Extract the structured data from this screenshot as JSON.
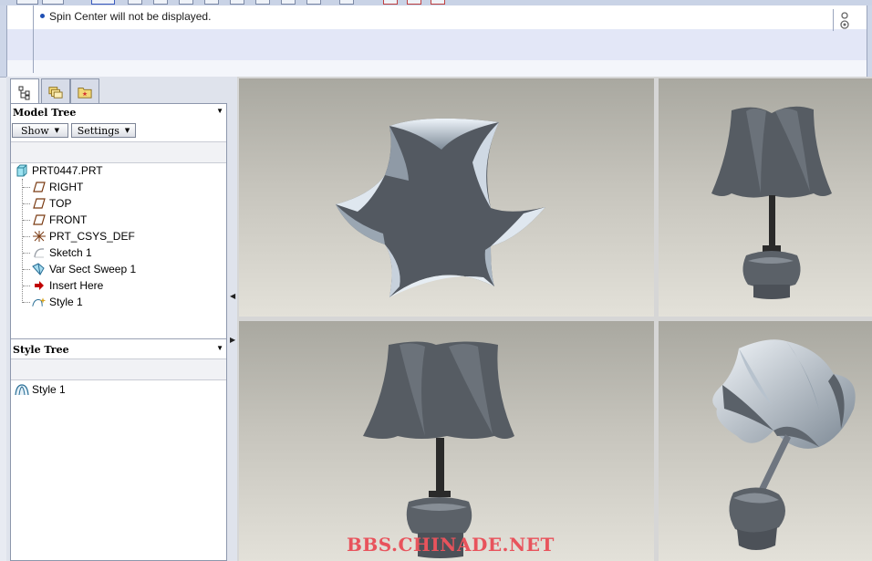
{
  "message_area": {
    "messages": [
      "Spin Center will not be displayed."
    ],
    "side_icon": "question-info-icon"
  },
  "panel_tabs": [
    {
      "name": "model-tree-tab-icon",
      "active": true
    },
    {
      "name": "folder-browser-tab-icon",
      "active": false
    },
    {
      "name": "favorites-tab-icon",
      "active": false
    }
  ],
  "model_tree": {
    "title": "Model Tree",
    "show_label": "Show",
    "settings_label": "Settings",
    "items": [
      {
        "label": "PRT0447.PRT",
        "icon": "part-icon"
      },
      {
        "label": "RIGHT",
        "icon": "datum-plane-icon"
      },
      {
        "label": "TOP",
        "icon": "datum-plane-icon"
      },
      {
        "label": "FRONT",
        "icon": "datum-plane-icon"
      },
      {
        "label": "PRT_CSYS_DEF",
        "icon": "coordinate-system-icon"
      },
      {
        "label": "Sketch 1",
        "icon": "sketch-icon"
      },
      {
        "label": "Var Sect Sweep 1",
        "icon": "sweep-icon"
      },
      {
        "label": "Insert Here",
        "icon": "insert-arrow-icon"
      },
      {
        "label": "Style 1",
        "icon": "style-icon"
      }
    ]
  },
  "style_tree": {
    "title": "Style Tree",
    "items": [
      {
        "label": "Style 1",
        "icon": "style-icon"
      }
    ]
  },
  "viewports": [
    {
      "name": "top-view",
      "view": "top"
    },
    {
      "name": "front-view",
      "view": "front"
    },
    {
      "name": "side-view",
      "view": "side"
    },
    {
      "name": "isometric-view",
      "view": "iso"
    }
  ],
  "watermark": "BBS.CHINADE.NET",
  "colors": {
    "link_blue": "#1f4fb4",
    "insert_red": "#c00000",
    "watermark": "#e8535c",
    "shade_dark": "#4a5058",
    "shade_light": "#e8eef6"
  }
}
